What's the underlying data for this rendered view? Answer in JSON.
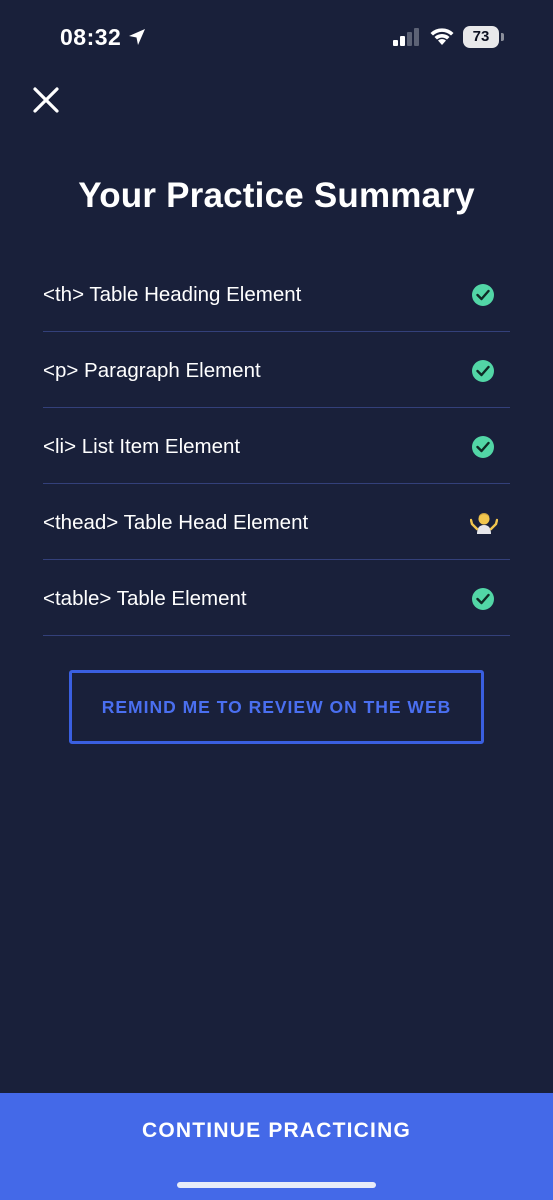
{
  "status_bar": {
    "time": "08:32",
    "battery": "73",
    "icons": [
      "location-arrow-icon",
      "cellular-signal-icon",
      "wifi-icon",
      "battery-icon"
    ]
  },
  "header": {
    "close_icon": "close-icon",
    "title": "Your Practice Summary"
  },
  "summary": {
    "items": [
      {
        "label": "<th> Table Heading Element",
        "status": "check",
        "icon": "check-circle-icon"
      },
      {
        "label": "<p> Paragraph Element",
        "status": "check",
        "icon": "check-circle-icon"
      },
      {
        "label": "<li> List Item Element",
        "status": "check",
        "icon": "check-circle-icon"
      },
      {
        "label": "<thead> Table Head Element",
        "status": "shrug",
        "icon": "shrug-emoji-icon"
      },
      {
        "label": "<table> Table Element",
        "status": "check",
        "icon": "check-circle-icon"
      }
    ]
  },
  "actions": {
    "remind_label": "REMIND ME TO REVIEW ON THE WEB",
    "continue_label": "CONTINUE PRACTICING"
  },
  "colors": {
    "background": "#19203a",
    "accent": "#4469e8",
    "check": "#52d6a6",
    "divider": "#33407a"
  }
}
